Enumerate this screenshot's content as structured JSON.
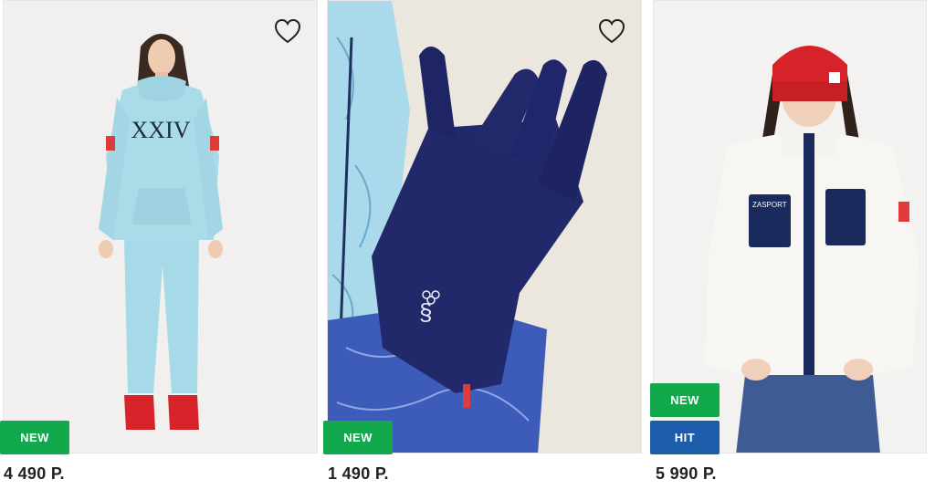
{
  "products": [
    {
      "name": "hoodie-tracksuit",
      "price": "4 490 Р.",
      "badges": [
        "NEW"
      ],
      "print_text": "XXIV",
      "favorite": false
    },
    {
      "name": "gloves",
      "price": "1 490 Р.",
      "badges": [
        "NEW"
      ],
      "favorite": false
    },
    {
      "name": "fleece-jacket",
      "price": "5 990 Р.",
      "badges": [
        "NEW",
        "HIT"
      ],
      "jacket_logo_text": "ZASPORT",
      "favorite": false
    }
  ],
  "colors": {
    "badge_new": "#12a84c",
    "badge_hit": "#1d5bab",
    "price_text": "#222222",
    "heart_icon": "#222222"
  },
  "icons": {
    "favorite": "heart-outline-icon"
  }
}
